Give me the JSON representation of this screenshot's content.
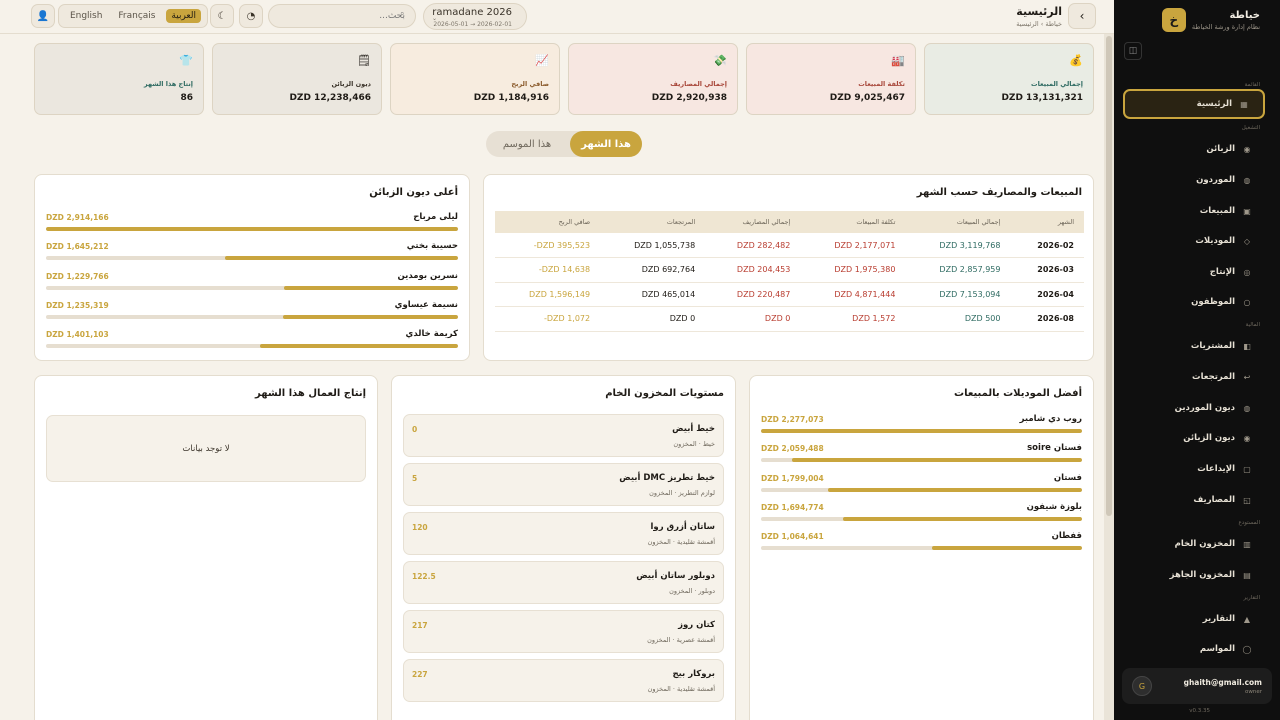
{
  "brand": {
    "name": "خياطة",
    "subtitle": "نظام إدارة ورشة الخياطة",
    "logo": "خ"
  },
  "sidebar": {
    "groups": [
      "القائمة",
      "التشغيل",
      "المالية",
      "المستودع",
      "التقارير"
    ],
    "items": [
      {
        "label": "الرئيسية",
        "icon": "grid-icon"
      },
      {
        "label": "الزبائن",
        "icon": "user-icon"
      },
      {
        "label": "الموردون",
        "icon": "truck-icon"
      },
      {
        "label": "المبيعات",
        "icon": "cart-icon"
      },
      {
        "label": "الموديلات",
        "icon": "tag-icon"
      },
      {
        "label": "الإنتاج",
        "icon": "factory-icon"
      },
      {
        "label": "الموظفون",
        "icon": "people-icon"
      },
      {
        "label": "المشتريات",
        "icon": "bag-icon"
      },
      {
        "label": "المرتجعات",
        "icon": "return-icon"
      },
      {
        "label": "ديون الموردين",
        "icon": "supplier-debt-icon"
      },
      {
        "label": "ديون الزبائن",
        "icon": "customer-debt-icon"
      },
      {
        "label": "الإيداعات",
        "icon": "deposit-icon"
      },
      {
        "label": "المصاريف",
        "icon": "expense-icon"
      },
      {
        "label": "المخزون الخام",
        "icon": "raw-stock-icon"
      },
      {
        "label": "المخزون الجاهز",
        "icon": "ready-stock-icon"
      },
      {
        "label": "التقارير",
        "icon": "report-icon"
      },
      {
        "label": "المواسم",
        "icon": "season-icon"
      }
    ],
    "user": {
      "email": "ghaith@gmail.com",
      "role": "owner",
      "initial": "G"
    },
    "version": "v0.3.35"
  },
  "topbar": {
    "title": "الرئيسية",
    "breadcrumb": "خياطة › الرئيسية",
    "season_name": "ramadane 2026",
    "season_dates": "2026-05-01 → 2026-02-01",
    "search_placeholder": "بحث...",
    "languages": [
      "العربية",
      "Français",
      "English"
    ]
  },
  "kpis": [
    {
      "label": "إجمالي المبيعات",
      "value": "DZD 13,131,321",
      "icon": "money-bag-icon",
      "glyph": "💰",
      "bg": "#e9ece4",
      "color": "#2f6b62"
    },
    {
      "label": "تكلفة المبيعات",
      "value": "DZD 9,025,467",
      "icon": "factory-icon",
      "glyph": "🏭",
      "bg": "#f7e7e1",
      "color": "#a8473a"
    },
    {
      "label": "إجمالي المصاريف",
      "value": "DZD 2,920,938",
      "icon": "cash-icon",
      "glyph": "💸",
      "bg": "#f7e7e1",
      "color": "#a8473a"
    },
    {
      "label": "صافي الربح",
      "value": "DZD 1,184,916",
      "icon": "chart-up-icon",
      "glyph": "📈",
      "bg": "#f7ecdf",
      "color": "#8a5a2b"
    },
    {
      "label": "ديون الزبائن",
      "value": "DZD 12,238,466",
      "icon": "ledger-icon",
      "glyph": "🗒",
      "bg": "#ebe7df",
      "color": "#3b342a"
    },
    {
      "label": "إنتاج هذا الشهر",
      "value": "86",
      "icon": "shirt-icon",
      "glyph": "👕",
      "bg": "#ebe7df",
      "color": "#2f6b62"
    }
  ],
  "period_toggle": {
    "this_month": "هذا الشهر",
    "this_season": "هذا الموسم"
  },
  "monthly": {
    "title": "المبيعات والمصاريف حسب الشهر",
    "headers": [
      "الشهر",
      "إجمالي المبيعات",
      "تكلفة المبيعات",
      "إجمالي المصاريف",
      "المرتجعات",
      "صافي الربح"
    ],
    "rows": [
      [
        "2026-02",
        "DZD 3,119,768",
        "DZD 2,177,071",
        "DZD 282,482",
        "DZD 1,055,738",
        "DZD 395,523-"
      ],
      [
        "2026-03",
        "DZD 2,857,959",
        "DZD 1,975,380",
        "DZD 204,453",
        "DZD 692,764",
        "DZD 14,638-"
      ],
      [
        "2026-04",
        "DZD 7,153,094",
        "DZD 4,871,444",
        "DZD 220,487",
        "DZD 465,014",
        "DZD 1,596,149"
      ],
      [
        "2026-08",
        "DZD 500",
        "DZD 1,572",
        "DZD 0",
        "DZD 0",
        "DZD 1,072-"
      ]
    ]
  },
  "top_debts": {
    "title": "أعلى ديون الزبائن",
    "items": [
      {
        "name": "ليلى مرباح",
        "value": "DZD 2,914,166",
        "pct": 100
      },
      {
        "name": "حسيبة بختي",
        "value": "DZD 1,645,212",
        "pct": 56.5
      },
      {
        "name": "نسرين بومدين",
        "value": "DZD 1,229,766",
        "pct": 42.2
      },
      {
        "name": "نسيمة عيساوي",
        "value": "DZD 1,235,319",
        "pct": 42.4
      },
      {
        "name": "كريمة خالدي",
        "value": "DZD 1,401,103",
        "pct": 48.1
      }
    ]
  },
  "top_models": {
    "title": "أفضل الموديلات بالمبيعات",
    "items": [
      {
        "name": "روب دي شامبر",
        "value": "DZD 2,277,073",
        "pct": 100
      },
      {
        "name": "فستان soire",
        "value": "DZD 2,059,488",
        "pct": 90.4
      },
      {
        "name": "فستان",
        "value": "DZD 1,799,004",
        "pct": 79
      },
      {
        "name": "بلوزة شيفون",
        "value": "DZD 1,694,774",
        "pct": 74.4
      },
      {
        "name": "قفطان",
        "value": "DZD 1,064,641",
        "pct": 46.8
      }
    ]
  },
  "inventory": {
    "title": "مستويات المخزون الخام",
    "items": [
      {
        "name": "خيط أبيض",
        "sub": "خيط · المخزون",
        "qty": "0"
      },
      {
        "name": "خيط تطريز DMC أبيض",
        "sub": "لوازم التطريز · المخزون",
        "qty": "5"
      },
      {
        "name": "ساتان أزرق روا",
        "sub": "أقمشة تقليدية · المخزون",
        "qty": "120"
      },
      {
        "name": "دوبلور ساتان أبيض",
        "sub": "دوبلور · المخزون",
        "qty": "122.5"
      },
      {
        "name": "كتان روز",
        "sub": "أقمشة عصرية · المخزون",
        "qty": "217"
      },
      {
        "name": "بروكار بيج",
        "sub": "أقمشة تقليدية · المخزون",
        "qty": "227"
      }
    ]
  },
  "workers": {
    "title": "إنتاج العمال هذا الشهر",
    "empty": "لا توجد بيانات"
  },
  "colors": {
    "accent": "#c9a53e",
    "sales": "#2f6b62",
    "cost": "#b83c2f",
    "sidebar_bg": "#0f0f0f"
  }
}
